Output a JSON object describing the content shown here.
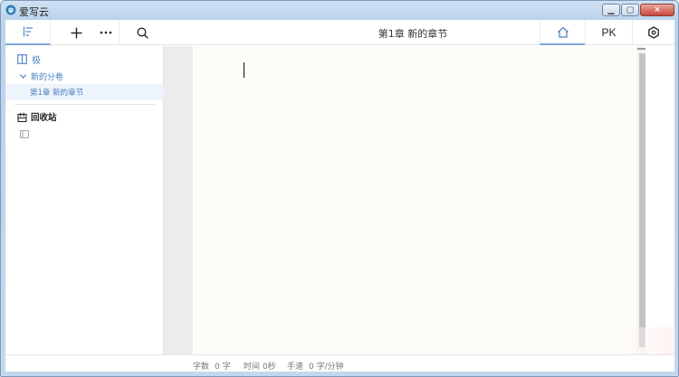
{
  "window": {
    "title": "爱写云",
    "minimize_icon": "minimize-icon",
    "maximize_icon": "maximize-icon",
    "close_icon": "close-icon"
  },
  "toolbar": {
    "outline_icon": "outline-menu-icon",
    "add_icon": "plus-icon",
    "more_icon": "more-dots-icon",
    "search_icon": "search-icon",
    "chapter_title": "第1章  新的章节",
    "home_icon": "home-icon",
    "pk_label": "PK",
    "settings_icon": "hexagon-settings-icon"
  },
  "sidebar": {
    "book_label": "极",
    "volume_label": "新的分卷",
    "chapter_label": "第1章   新的章节",
    "trash_label": "回收站"
  },
  "status": {
    "word_count_label": "字数",
    "word_count_value": "0 字",
    "time_label": "时间",
    "time_value": "0秒",
    "speed_label": "手速",
    "speed_value": "0 字/分钟"
  },
  "colors": {
    "accent": "#4a7fc1",
    "title_gradient_top": "#cfe0f2",
    "paper": "#fdfcf9",
    "gutter": "#ececec",
    "selected_row": "#eef4fb"
  }
}
